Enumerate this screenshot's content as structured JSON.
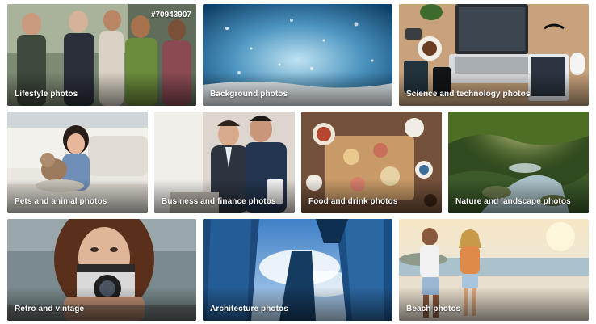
{
  "gallery": {
    "tiles": [
      {
        "label": "Lifestyle photos",
        "id_tag": "#70943907"
      },
      {
        "label": "Background photos"
      },
      {
        "label": "Science and technology photos"
      },
      {
        "label": "Pets and animal photos"
      },
      {
        "label": "Business and finance photos"
      },
      {
        "label": "Food and drink photos"
      },
      {
        "label": "Nature and landscape photos"
      },
      {
        "label": "Retro and vintage"
      },
      {
        "label": "Architecture photos"
      },
      {
        "label": "Beach photos"
      }
    ]
  }
}
